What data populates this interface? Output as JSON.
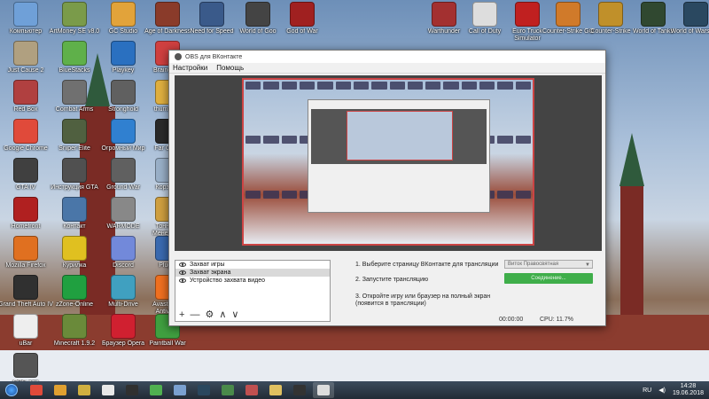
{
  "desktop": {
    "icons": [
      {
        "label": "Компьютер",
        "color": "#6fa0d8"
      },
      {
        "label": "ArtMoney SE v8.0",
        "color": "#7a9b4a"
      },
      {
        "label": "GC Studio",
        "color": "#e2a33a"
      },
      {
        "label": "Age of Darkness",
        "color": "#8a3b2a"
      },
      {
        "label": "Need for Speed",
        "color": "#3a5a8a"
      },
      {
        "label": "World of Goo",
        "color": "#444444"
      },
      {
        "label": "God of War",
        "color": "#a02020"
      },
      {
        "label": "Warthunder",
        "color": "#a33030"
      },
      {
        "label": "Call of Duty",
        "color": "#dddddd"
      },
      {
        "label": "Euro Truck Simulator",
        "color": "#c02020"
      },
      {
        "label": "Counter-Strike GO",
        "color": "#d07a2a"
      },
      {
        "label": "Counter-Strike",
        "color": "#c0902a"
      },
      {
        "label": "World of Tanks",
        "color": "#304830"
      },
      {
        "label": "World of Warships",
        "color": "#2a4860"
      },
      {
        "label": "Just Cause 2",
        "color": "#b0a080"
      },
      {
        "label": "BlueStacks",
        "color": "#5fb04a"
      },
      {
        "label": "Playkey",
        "color": "#2a70c0"
      },
      {
        "label": "Braindead",
        "color": "#d04040"
      },
      {
        "label": "Red Box",
        "color": "#b04040"
      },
      {
        "label": "Combat Arms",
        "color": "#707070"
      },
      {
        "label": "Stronghold",
        "color": "#606060"
      },
      {
        "label": "thumbnail",
        "color": "#e0b040"
      },
      {
        "label": "Google Chrome",
        "color": "#e04a3a"
      },
      {
        "label": "Sniper Elite",
        "color": "#506040"
      },
      {
        "label": "Огромный Мир",
        "color": "#3080d0"
      },
      {
        "label": "Far Cry 3",
        "color": "#2a2a2a"
      },
      {
        "label": "GTA IV",
        "color": "#404040"
      },
      {
        "label": "Инструкция GTA",
        "color": "#505050"
      },
      {
        "label": "Ground War",
        "color": "#606060"
      },
      {
        "label": "Корзина",
        "color": "#9ab0c8"
      },
      {
        "label": "Homefront",
        "color": "#b02020"
      },
      {
        "label": "Контакт",
        "color": "#4a76a8"
      },
      {
        "label": "WARMODE",
        "color": "#888888"
      },
      {
        "label": "Тоннель Менеджер",
        "color": "#d0a040"
      },
      {
        "label": "Mozilla Firefox",
        "color": "#e07020"
      },
      {
        "label": "Курилка",
        "color": "#e0c020"
      },
      {
        "label": "Discord",
        "color": "#7289da"
      },
      {
        "label": "Plugin",
        "color": "#3a6ab0"
      },
      {
        "label": "Grand Theft Auto IV",
        "color": "#303030"
      },
      {
        "label": "zZone-Online",
        "color": "#20a040"
      },
      {
        "label": "Multi-Drive",
        "color": "#40a0c0"
      },
      {
        "label": "Avast Free Antivirus",
        "color": "#f07020"
      },
      {
        "label": "uBar",
        "color": "#eeeeee"
      },
      {
        "label": "Minecraft 1.9.2",
        "color": "#6a8a3a"
      },
      {
        "label": "Браузер Opera",
        "color": "#d02030"
      },
      {
        "label": "Paintball War",
        "color": "#40a040"
      },
      {
        "label": "OBS для ВКонтакте",
        "color": "#555555"
      }
    ]
  },
  "obs_window": {
    "title": "OBS для ВКонтакте",
    "menu": [
      "Настройки",
      "Помощь"
    ],
    "sources": [
      {
        "label": "Захват игры",
        "selected": false
      },
      {
        "label": "Захват экрана",
        "selected": true
      },
      {
        "label": "Устройство захвата видео",
        "selected": false
      }
    ],
    "source_tools": [
      "+",
      "—",
      "⚙",
      "∧",
      "∨"
    ],
    "steps": {
      "step1": "1. Выберите страницу ВКонтакте для трансляции",
      "step1_select": "Виток Правосвятная",
      "step2": "2. Запустите трансляцию",
      "step2_button": "Соединение...",
      "step3_line1": "3. Откройте игру или браузер на полный экран",
      "step3_line2": "(появится в трансляции)"
    },
    "status": {
      "time": "00:00:00",
      "cpu": "CPU: 11.7%"
    }
  },
  "taskbar": {
    "apps": [
      {
        "name": "chrome-icon",
        "color": "#e04a3a"
      },
      {
        "name": "media-player-icon",
        "color": "#e0a030"
      },
      {
        "name": "archive-icon",
        "color": "#d0b040"
      },
      {
        "name": "notepad-icon",
        "color": "#e8e8e8"
      },
      {
        "name": "terminal-icon",
        "color": "#303030"
      },
      {
        "name": "torrent-icon",
        "color": "#50b050"
      },
      {
        "name": "mail-icon",
        "color": "#7aa0d0"
      },
      {
        "name": "steam-icon",
        "color": "#2a475e"
      },
      {
        "name": "nox-icon",
        "color": "#4a8a4a"
      },
      {
        "name": "cubes-icon",
        "color": "#c05050"
      },
      {
        "name": "folder-icon",
        "color": "#e0c060"
      },
      {
        "name": "record-icon",
        "color": "#333333"
      },
      {
        "name": "obs-icon",
        "color": "#dddddd"
      }
    ],
    "language": "RU",
    "time": "14:28",
    "date": "19.06.2018"
  }
}
